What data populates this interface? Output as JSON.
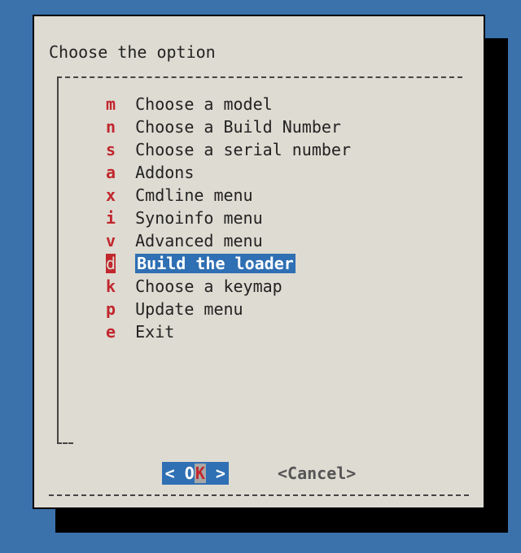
{
  "dialog": {
    "title": "Choose the option",
    "selected_index": 7,
    "items": [
      {
        "key": "m",
        "label": "Choose a model"
      },
      {
        "key": "n",
        "label": "Choose a Build Number"
      },
      {
        "key": "s",
        "label": "Choose a serial number"
      },
      {
        "key": "a",
        "label": "Addons"
      },
      {
        "key": "x",
        "label": "Cmdline menu"
      },
      {
        "key": "i",
        "label": "Synoinfo menu"
      },
      {
        "key": "v",
        "label": "Advanced menu"
      },
      {
        "key": "d",
        "label": "Build the loader"
      },
      {
        "key": "k",
        "label": "Choose a keymap"
      },
      {
        "key": "p",
        "label": "Update menu"
      },
      {
        "key": "e",
        "label": "Exit"
      }
    ],
    "buttons": {
      "ok_open": "<  ",
      "ok_pre": "O",
      "ok_hot": "K",
      "ok_close": "  >",
      "cancel": "<Cancel>"
    }
  },
  "colors": {
    "background": "#3b72ab",
    "panel": "#dedbd2",
    "accent": "#2f6fb3",
    "hotkey": "#c1272d"
  }
}
